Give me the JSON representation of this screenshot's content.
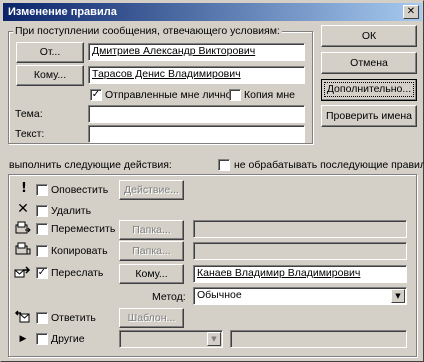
{
  "window": {
    "title": "Изменение правила",
    "close_glyph": "✕"
  },
  "buttons": {
    "ok": "ОК",
    "cancel": "Отмена",
    "advanced": "Дополнительно...",
    "check_names": "Проверить имена"
  },
  "conditions": {
    "group_label": "При поступлении сообщения, отвечающего условиям:",
    "from_button": "От...",
    "from_value": "Дмитриев Александр Викторович",
    "to_button": "Кому...",
    "to_value": "Тарасов Денис Владимирович",
    "sent_only_to_me": {
      "label": "Отправленные мне лично",
      "checked": true
    },
    "copy_to_me": {
      "label": "Копия мне",
      "checked": false
    },
    "subject_label": "Тема:",
    "subject_value": "",
    "body_label": "Текст:",
    "body_value": ""
  },
  "actions": {
    "group_label": "выполнить следующие действия:",
    "stop_processing": {
      "label": "не обрабатывать последующие правила",
      "checked": false
    },
    "rows": [
      {
        "label": "Оповестить",
        "checked": false,
        "button": "Действие...",
        "icon": "exclamation-icon"
      },
      {
        "label": "Удалить",
        "checked": false,
        "icon": "delete-x-icon"
      },
      {
        "label": "Переместить",
        "checked": false,
        "button": "Папка...",
        "value": "",
        "icon": "move-to-folder-icon"
      },
      {
        "label": "Копировать",
        "checked": false,
        "button": "Папка...",
        "value": "",
        "icon": "copy-to-folder-icon"
      },
      {
        "label": "Переслать",
        "checked": true,
        "button": "Кому...",
        "value": "Канаев Владимир Владимирович",
        "icon": "forward-icon"
      },
      {
        "label": "Ответить",
        "checked": false,
        "button": "Шаблон...",
        "icon": "reply-icon"
      },
      {
        "label": "Другие",
        "checked": false,
        "select_value": "",
        "value": "",
        "icon": "play-arrow-icon"
      }
    ],
    "method_label": "Метод:",
    "method_value": "Обычное"
  }
}
